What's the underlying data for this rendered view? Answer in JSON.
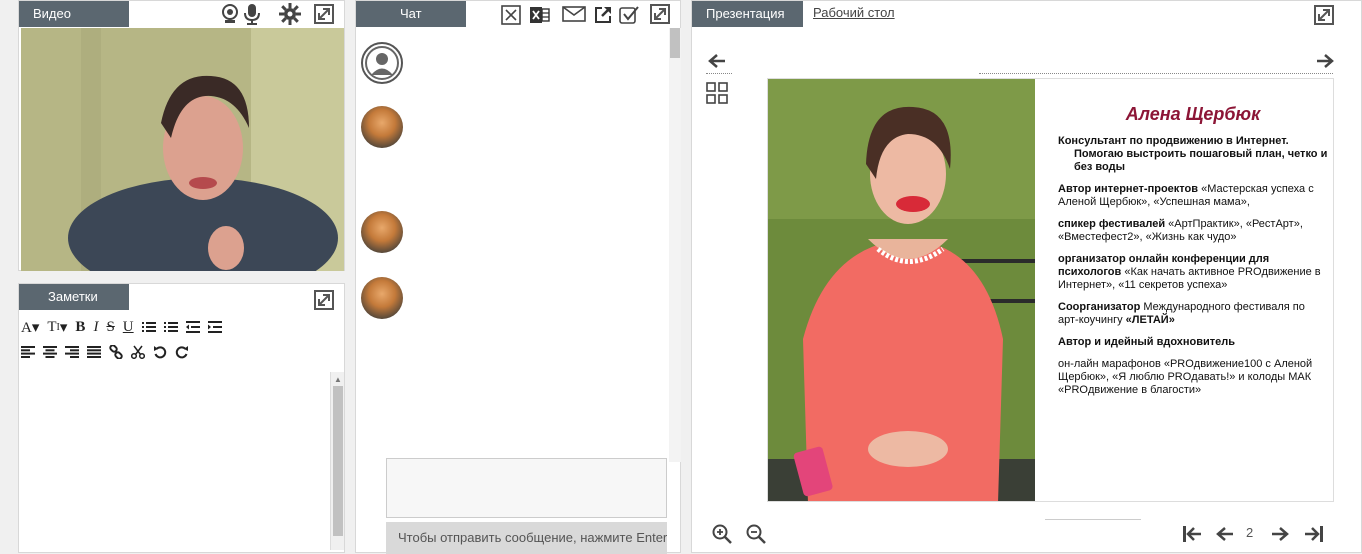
{
  "video": {
    "tab_label": "Видео"
  },
  "notes": {
    "tab_label": "Заметки"
  },
  "chat": {
    "tab_label": "Чат",
    "send_hint": "Чтобы отправить сообщение, нажмите Enter"
  },
  "presentation": {
    "tab_label": "Презентация",
    "desktop_tab_label": "Рабочий стол",
    "page_number": "2",
    "slide": {
      "name": "Алена Щербюк",
      "p1": "Консультант по продвижению в Интернет.",
      "p1b": "Помогаю выстроить пошаговый план, четко и без воды",
      "p2_bold": "Автор интернет-проектов",
      "p2": " «Мастерская успеха с Аленой Щербюк», «Успешная мама»,",
      "p3_bold": "спикер фестивалей",
      "p3": " «АртПрактик», «РестАрт», «Вместефест2», «Жизнь как чудо»",
      "p4_bold": "организатор онлайн конференции для психологов",
      "p4": " «Как начать активное PROдвижение в Интернет», «11 секретов успеха»",
      "p5_bold": "Соорганизатор",
      "p5": " Международного фестиваля по арт-коучингу ",
      "p5_bold2": "«ЛЕТАЙ»",
      "p6_bold": "Автор и идейный вдохновитель",
      "p7": "он-лайн марафонов «PROдвижение100 с Аленой Щербюк», «Я люблю PROдавать!» и колоды МАК «PROдвижение в благости»"
    }
  },
  "colors": {
    "tab_bg": "#5b6770",
    "accent_name": "#8c1536"
  }
}
